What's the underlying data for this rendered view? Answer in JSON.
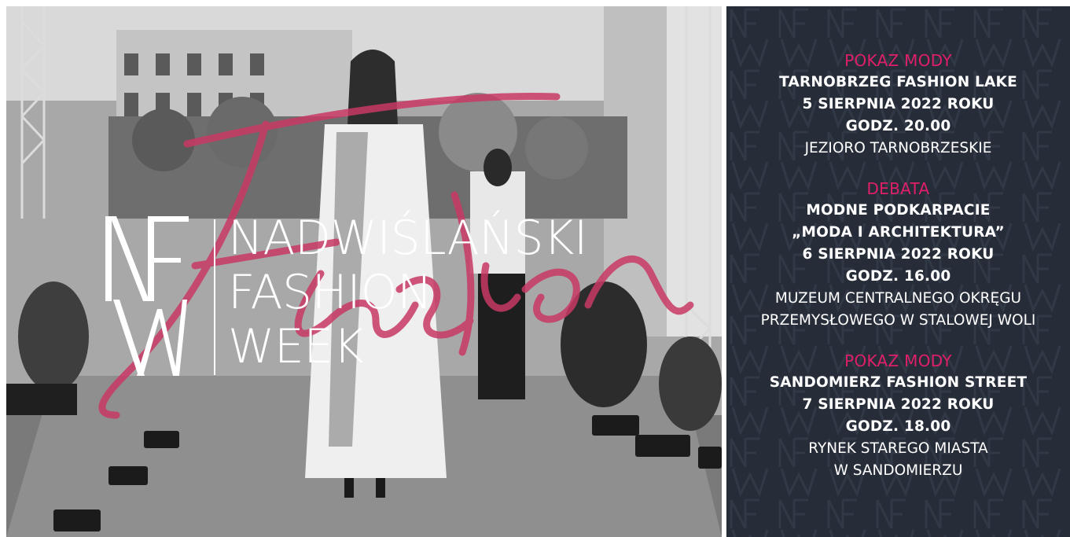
{
  "brand": {
    "monogram": "NFW",
    "lines": [
      "NADWIŚLAŃSKI",
      "FASHION",
      "WEEK"
    ],
    "script_word": "Fashion"
  },
  "colors": {
    "accent": "#e01f68",
    "panel": "#272d38",
    "script": "#c83a64"
  },
  "events": [
    {
      "kind": "POKAZ MODY",
      "lines_bold": [
        "TARNOBRZEG FASHION LAKE",
        "5 SIERPNIA 2022 ROKU",
        "GODZ. 20.00"
      ],
      "lines_regular": [
        "JEZIORO TARNOBRZESKIE"
      ]
    },
    {
      "kind": "DEBATA",
      "lines_bold": [
        "MODNE PODKARPACIE",
        "„MODA I ARCHITEKTURA”",
        "6 SIERPNIA 2022 ROKU",
        "GODZ. 16.00"
      ],
      "lines_regular": [
        "MUZEUM CENTRALNEGO OKRĘGU",
        "PRZEMYSŁOWEGO W STALOWEJ WOLI"
      ]
    },
    {
      "kind": "POKAZ MODY",
      "lines_bold": [
        "SANDOMIERZ FASHION STREET",
        "7 SIERPNIA 2022 ROKU",
        "GODZ. 18.00"
      ],
      "lines_regular": [
        "RYNEK STAREGO MIASTA",
        "W SANDOMIERZU"
      ]
    }
  ]
}
